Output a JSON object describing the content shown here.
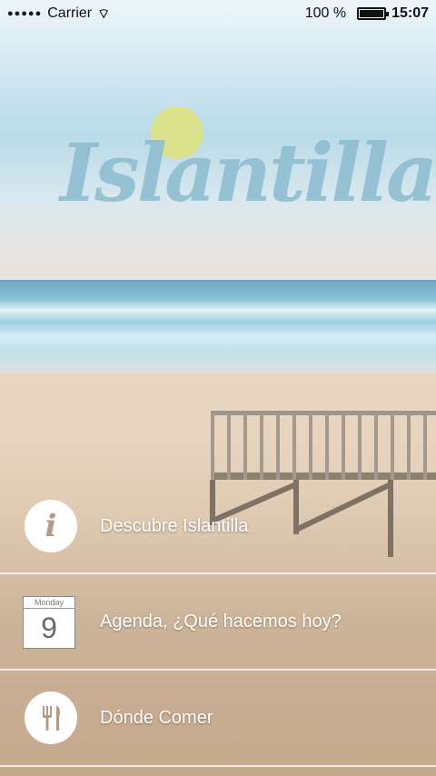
{
  "status_bar": {
    "signal": "●●●●●",
    "carrier": "Carrier",
    "wifi_icon": "wifi-icon",
    "battery_percent": "100 %",
    "battery_level": 1.0,
    "time": "15:07"
  },
  "header": {
    "logo_text": "Islantilla"
  },
  "menu": {
    "items": [
      {
        "label": "Descubre Islantilla",
        "icon": "info-icon",
        "icon_glyph": "i"
      },
      {
        "label": "Agenda, ¿Qué hacemos hoy?",
        "icon": "calendar-icon",
        "calendar_day": "Monday",
        "calendar_number": "9"
      },
      {
        "label": "Dónde Comer",
        "icon": "fork-knife-icon"
      }
    ]
  },
  "colors": {
    "logo": "#8dbdd0",
    "sun": "#dfe37a",
    "menu_text": "#ffffff"
  }
}
